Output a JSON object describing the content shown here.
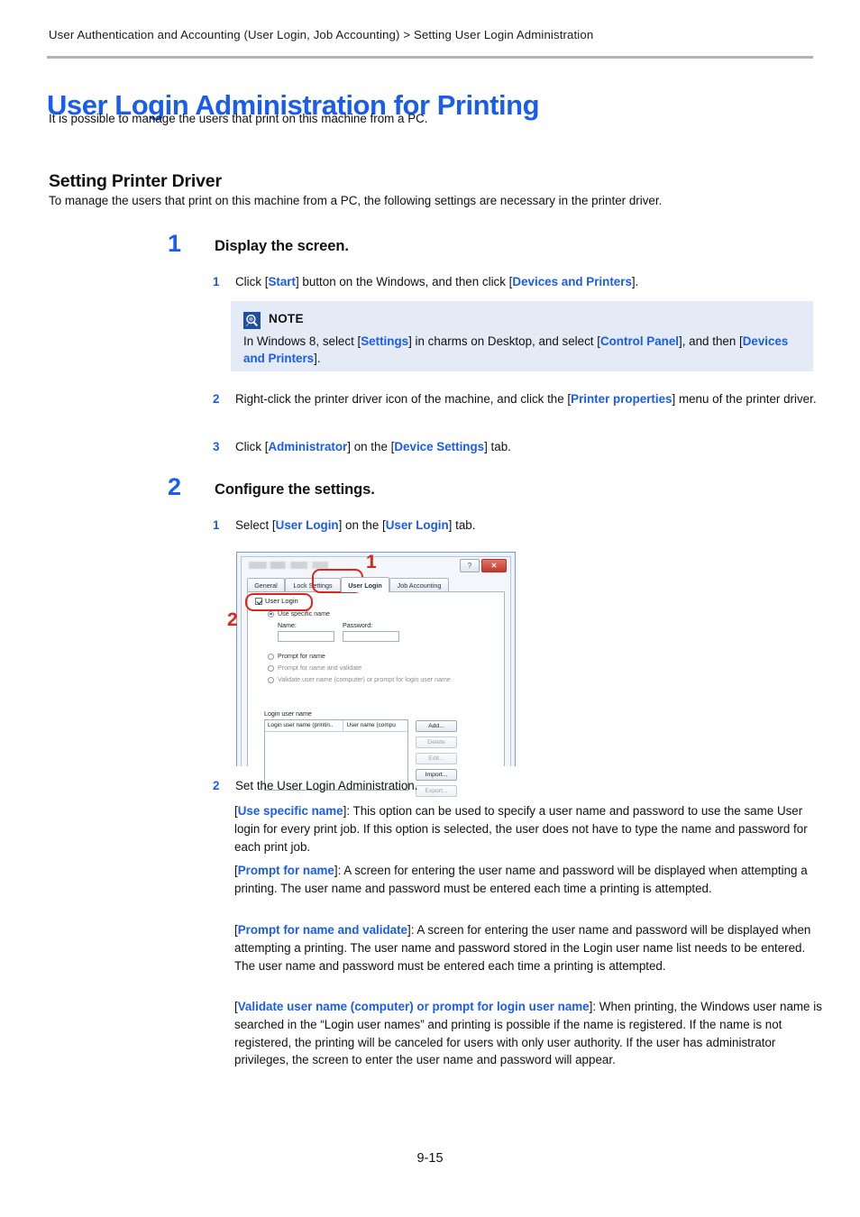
{
  "breadcrumb": "User Authentication and Accounting (User Login, Job Accounting) > Setting User Login Administration",
  "title": "User Login Administration for Printing",
  "intro": "It is possible to manage the users that print on this machine from a PC.",
  "section": {
    "heading": "Setting Printer Driver",
    "lead": "To manage the users that print on this machine from a PC, the following settings are necessary in the printer driver."
  },
  "steps": [
    {
      "number": "1",
      "title": "Display the screen."
    },
    {
      "number": "2",
      "title": "Configure the settings."
    }
  ],
  "substeps": {
    "s1_1": {
      "number": "1",
      "pre": "Click [",
      "link1": "Start",
      "mid": "] button on the Windows, and then click [",
      "link2": "Devices and Printers",
      "post": "]."
    },
    "s1_2": {
      "number": "2",
      "pre": "Right-click the printer driver icon of the machine, and click the [",
      "link1": "Printer properties",
      "post": "] menu of the printer driver."
    },
    "s1_3": {
      "number": "3",
      "pre": "Click [",
      "link1": "Administrator",
      "mid": "] on the [",
      "link2": "Device Settings",
      "post": "] tab."
    },
    "s2_1": {
      "number": "1",
      "pre": "Select [",
      "link1": "User Login",
      "mid": "] on the [",
      "link2": "User Login",
      "post": "] tab."
    },
    "s2_2": {
      "number": "2",
      "text": "Set the User Login Administration."
    }
  },
  "note": {
    "icon": "note-info-icon",
    "label": "NOTE",
    "pre": "In Windows 8, select [",
    "link1": "Settings",
    "mid": "] in charms on Desktop, and select [",
    "link2": "Control Panel",
    "mid2": "], and then [",
    "link3": "Devices and Printers",
    "post": "]."
  },
  "dialog": {
    "title_blurred": "",
    "help_button": "?",
    "close_button": "✕",
    "tabs": [
      {
        "label": "General",
        "active": false
      },
      {
        "label": "Lock Settings",
        "active": false
      },
      {
        "label": "User Login",
        "active": true
      },
      {
        "label": "Job Accounting",
        "active": false
      }
    ],
    "checkbox_label": "User Login",
    "radio_use_specific": "Use specific name",
    "name_label": "Name:",
    "password_label": "Password:",
    "radio_prompt": "Prompt for name",
    "radio_prompt_validate": "Prompt for name and validate",
    "radio_validate": "Validate user name (computer) or prompt for login user name",
    "list_label": "Login user name",
    "list_columns": [
      "Login user name (printin..",
      "User name (compu"
    ],
    "buttons": [
      {
        "label": "Add...",
        "enabled": true
      },
      {
        "label": "Delete",
        "enabled": false
      },
      {
        "label": "Edit...",
        "enabled": false
      },
      {
        "label": "Import...",
        "enabled": true
      },
      {
        "label": "Export...",
        "enabled": false
      }
    ],
    "callouts": [
      {
        "number": "1",
        "target": "user-login-tab"
      },
      {
        "number": "2",
        "target": "user-login-checkbox"
      }
    ]
  },
  "paragraphs": [
    {
      "link": "Use specific name",
      "text": "]: This option can be used to specify a user name and password to use the same User login for every print job. If this option is selected, the user does not have to type the name and password for each print job."
    },
    {
      "link": "Prompt for name",
      "text": "]: A screen for entering the user name and password will be displayed when attempting a printing. The user name and password must be entered each time a printing is attempted."
    },
    {
      "link": "Prompt for name and validate",
      "text": "]: A screen for entering the user name and password will be displayed when attempting a printing. The user name and password stored in the Login user name list needs to be entered. The user name and password must be entered each time a printing is attempted."
    },
    {
      "link": "Validate user name (computer) or prompt for login user name",
      "text": "]: When printing, the Windows user name is searched in the “Login user names” and printing is possible if the name is registered. If the name is not registered, the printing will be canceled for users with only user authority. If the user has administrator privileges, the screen to enter the user name and password will appear."
    }
  ],
  "page_number": "9-15",
  "colors": {
    "accent_blue": "#1a5cec",
    "callout_red": "#e2231a",
    "note_bg": "#e4ebf7",
    "rule_gray": "#b3b3b3"
  }
}
